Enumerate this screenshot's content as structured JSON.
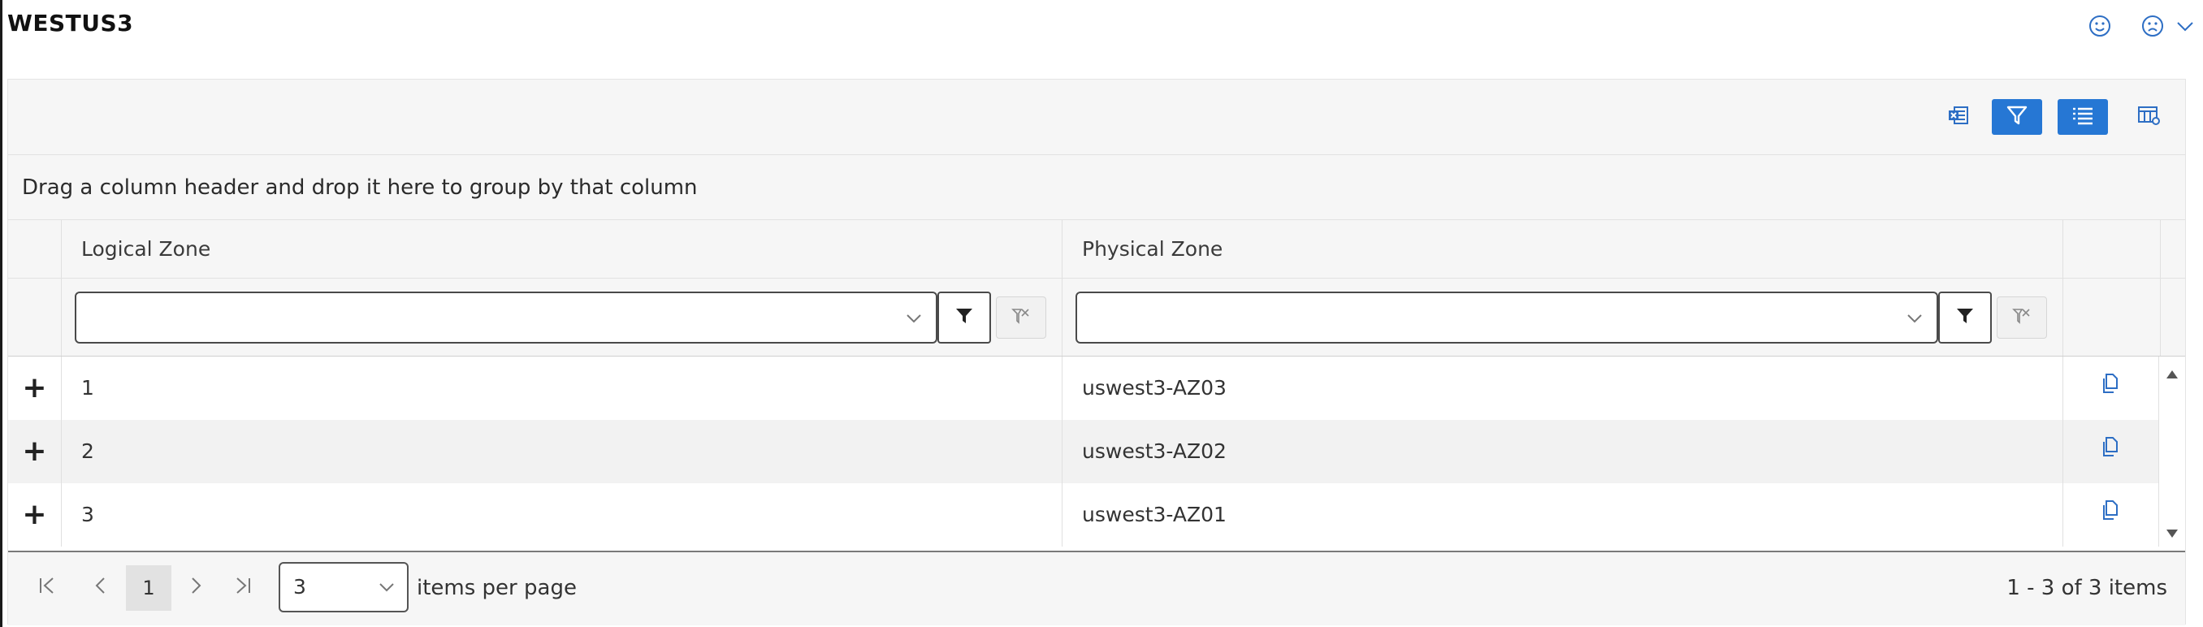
{
  "title": "WESTUS3",
  "feedback": {
    "smile_icon": "smile-icon",
    "frown_icon": "frown-icon",
    "expand_icon": "chevron-down-icon"
  },
  "toolbar": {
    "excel_icon": "excel-export-icon",
    "filter_icon": "filter-icon",
    "list_icon": "list-icon",
    "column_icon": "column-chooser-icon"
  },
  "group_panel": {
    "text": "Drag a column header and drop it here to group by that column"
  },
  "columns": [
    {
      "label": "Logical Zone"
    },
    {
      "label": "Physical Zone"
    }
  ],
  "filters": {
    "logical": {
      "value": ""
    },
    "physical": {
      "value": ""
    }
  },
  "rows": [
    {
      "logical": "1",
      "physical": "uswest3-AZ03"
    },
    {
      "logical": "2",
      "physical": "uswest3-AZ02"
    },
    {
      "logical": "3",
      "physical": "uswest3-AZ01"
    }
  ],
  "pager": {
    "current_page": "1",
    "page_size": "3",
    "items_per_page_label": "items per page",
    "range_text": "1 - 3 of 3 items"
  },
  "colors": {
    "accent": "#2677d4",
    "icon_blue": "#2d6ec4"
  }
}
